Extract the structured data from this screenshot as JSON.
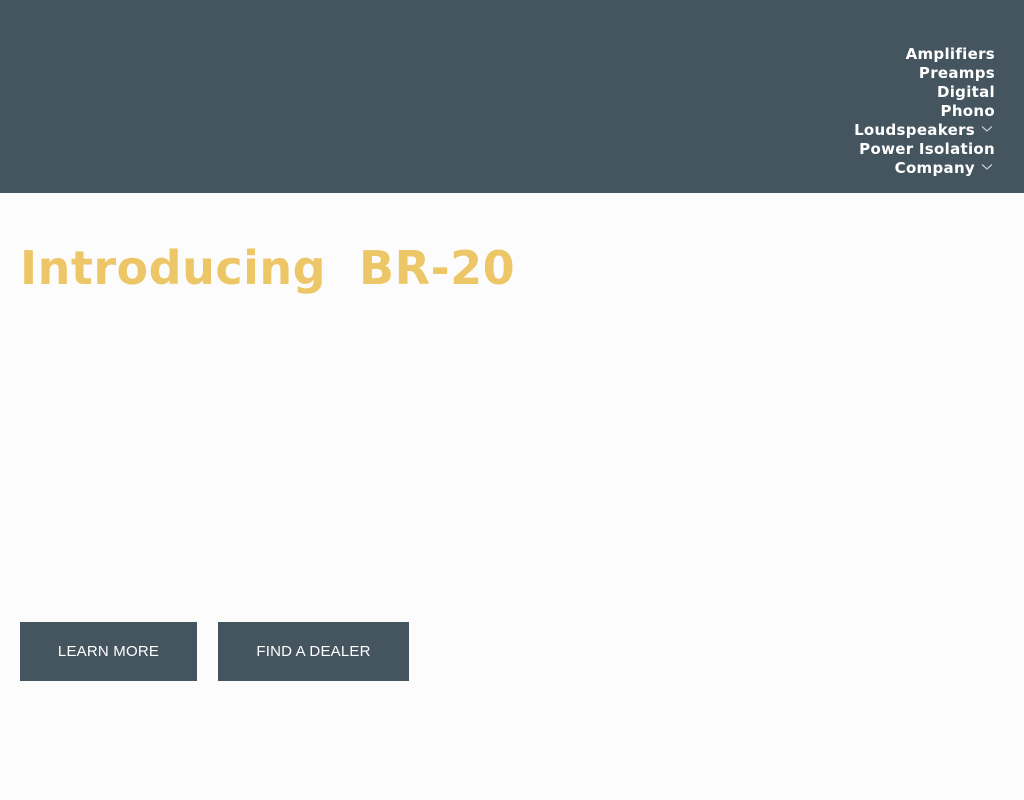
{
  "nav": {
    "items": [
      {
        "label": "Amplifiers",
        "has_submenu": false
      },
      {
        "label": "Preamps",
        "has_submenu": false
      },
      {
        "label": "Digital",
        "has_submenu": false
      },
      {
        "label": "Phono",
        "has_submenu": false
      },
      {
        "label": "Loudspeakers",
        "has_submenu": true
      },
      {
        "label": "Power Isolation",
        "has_submenu": false
      },
      {
        "label": "Company",
        "has_submenu": true
      }
    ]
  },
  "hero": {
    "title": "Introducing  BR-20",
    "learn_more_label": "LEARN MORE",
    "find_dealer_label": "FIND A DEALER"
  },
  "colors": {
    "header_bg": "#45555f",
    "accent": "#ecc667",
    "page_bg": "#fcfcfc"
  },
  "icons": {
    "submenu": "chevron-down-icon"
  }
}
